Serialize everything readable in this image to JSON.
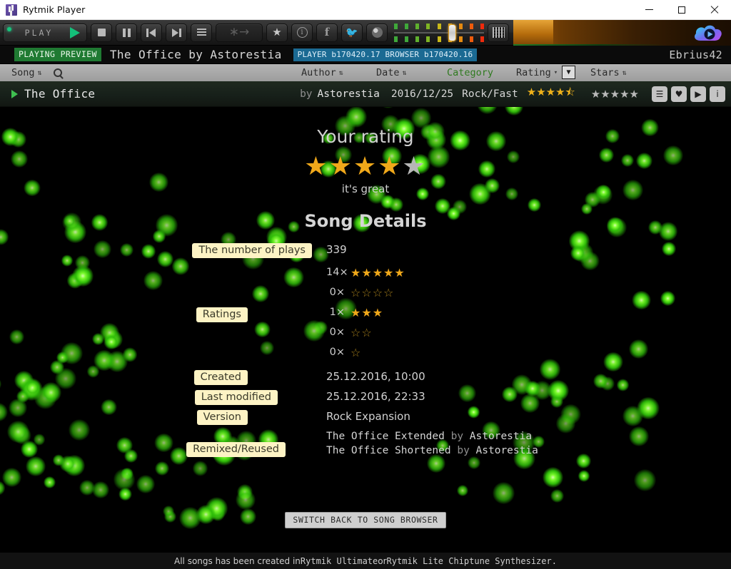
{
  "window": {
    "title": "Rytmik Player",
    "icon": "app-icon",
    "controls": {
      "minimize": "minimize",
      "maximize": "maximize",
      "close": "close"
    }
  },
  "toolbar": {
    "play_label": "PLAY",
    "buttons": [
      {
        "name": "play",
        "label": "PLAY",
        "icon": "play-triangle-icon"
      },
      {
        "name": "stop",
        "label": "Stop",
        "icon": "stop-icon"
      },
      {
        "name": "pause",
        "label": "Pause",
        "icon": "pause-icon"
      },
      {
        "name": "previous",
        "label": "Previous",
        "icon": "previous-icon"
      },
      {
        "name": "next",
        "label": "Next",
        "icon": "next-icon"
      },
      {
        "name": "playlist",
        "label": "Playlist",
        "icon": "list-icon"
      },
      {
        "name": "shuffle",
        "label": "Shuffle",
        "icon": "shuffle-icon"
      },
      {
        "name": "favorite",
        "label": "Favorite",
        "icon": "star-icon"
      },
      {
        "name": "info",
        "label": "Info",
        "icon": "info-icon"
      },
      {
        "name": "facebook",
        "label": "Facebook",
        "icon": "facebook-icon"
      },
      {
        "name": "twitter",
        "label": "Twitter",
        "icon": "twitter-icon"
      },
      {
        "name": "web",
        "label": "Web",
        "icon": "globe-icon"
      },
      {
        "name": "equalizer",
        "label": "Equalizer",
        "icon": "equalizer-icon"
      }
    ],
    "volume": {
      "level": 6,
      "steps": 9
    },
    "cloud_icon": "cloud-play-icon"
  },
  "status": {
    "playing_badge": "PLAYING PREVIEW",
    "now_playing": "The Office by Astorestia",
    "build_badge": "PLAYER b170420.17 BROWSER b170420.16",
    "user": "Ebrius42"
  },
  "columns": [
    {
      "name": "song",
      "label": "Song",
      "sortable": true,
      "active": false
    },
    {
      "name": "author",
      "label": "Author",
      "sortable": true,
      "active": false
    },
    {
      "name": "date",
      "label": "Date",
      "sortable": true,
      "active": false
    },
    {
      "name": "category",
      "label": "Category",
      "sortable": false,
      "active": true
    },
    {
      "name": "rating",
      "label": "Rating",
      "sortable": true,
      "active": false
    },
    {
      "name": "stars",
      "label": "Stars",
      "sortable": true,
      "active": false
    }
  ],
  "search_icon": "search-icon",
  "filter_icon": "filter-icon",
  "song_row": {
    "title": "The Office",
    "by_label": "by",
    "author": "Astorestia",
    "date": "2016/12/25",
    "category": "Rock/Fast",
    "rating_stars": "★★★★⯪",
    "stars_count": "★★★★★",
    "actions": [
      {
        "name": "notes",
        "glyph": "☰"
      },
      {
        "name": "favorite",
        "glyph": "♥"
      },
      {
        "name": "play",
        "glyph": "▶"
      },
      {
        "name": "info",
        "glyph": "i"
      }
    ]
  },
  "rating_panel": {
    "heading": "Your rating",
    "stars_filled": 4,
    "stars_total": 5,
    "caption": "it's great"
  },
  "details": {
    "heading": "Song Details",
    "plays_label": "The number of plays",
    "plays_value": "339",
    "ratings_label": "Ratings",
    "ratings_breakdown": [
      {
        "count": "14×",
        "stars": 5,
        "filled": true
      },
      {
        "count": "0×",
        "stars": 4,
        "filled": false
      },
      {
        "count": "1×",
        "stars": 3,
        "filled": true
      },
      {
        "count": "0×",
        "stars": 2,
        "filled": false
      },
      {
        "count": "0×",
        "stars": 1,
        "filled": false
      }
    ],
    "created_label": "Created",
    "created_value": "25.12.2016, 10:00",
    "modified_label": "Last modified",
    "modified_value": "25.12.2016, 22:33",
    "version_label": "Version",
    "version_value": "Rock Expansion",
    "remixed_label": "Remixed/Reused",
    "remixed": [
      {
        "title": "The Office Extended",
        "by": "by",
        "author": "Astorestia"
      },
      {
        "title": "The Office Shortened",
        "by": "by",
        "author": "Astorestia"
      }
    ]
  },
  "switch_button": "SWITCH BACK TO SONG BROWSER",
  "footer": {
    "text_a": "All songs has been created in ",
    "text_b": "Rytmik Ultimate",
    "text_c": " or ",
    "text_d": "Rytmik Lite Chiptune Synthesizer."
  },
  "colors": {
    "accent_green": "#1f7a32",
    "badge_blue": "#1b6a93",
    "star_gold": "#f0a81a",
    "label_cream": "#fdf3c4",
    "particle_green": "#7dff2e"
  }
}
